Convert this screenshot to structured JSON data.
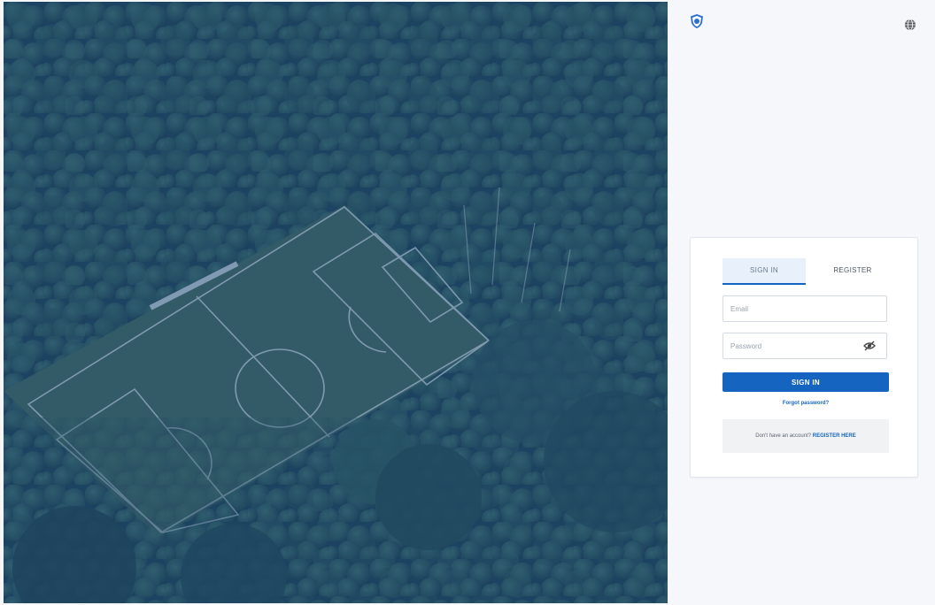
{
  "header": {
    "logo_icon": "shield-logo-icon",
    "language_icon": "globe-icon"
  },
  "hero": {
    "icon": "aerial-soccer-field-image",
    "overlay_color": "#1f4a7a"
  },
  "login": {
    "tabs": [
      {
        "label": "SIGN IN",
        "active": true
      },
      {
        "label": "REGISTER",
        "active": false
      }
    ],
    "email": {
      "placeholder": "Email",
      "value": ""
    },
    "password": {
      "placeholder": "Password",
      "value": "",
      "toggle_icon": "eye-off-icon"
    },
    "submit_label": "SIGN IN",
    "forgot_label": "Forgot password?",
    "register_prompt": "Don't have an account?",
    "register_link": "REGISTER HERE"
  },
  "colors": {
    "primary": "#1565c0",
    "panel_bg": "#f5f7fb",
    "tab_active_bg": "#e8f1fb"
  }
}
